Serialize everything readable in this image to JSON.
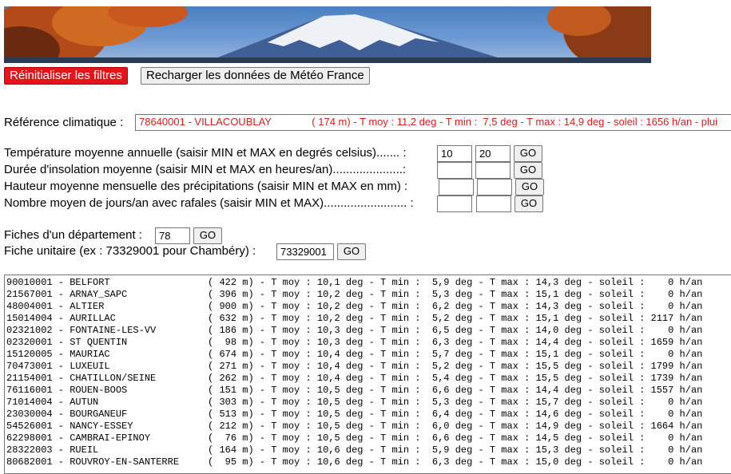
{
  "buttons": {
    "reset": "Réinitialiser les filtres",
    "reload": "Recharger les données de Météo France"
  },
  "reference": {
    "label": "Référence climatique :",
    "value": "78640001 - VILLACOUBLAY              ( 174 m) - T moy : 11,2 deg - T min :  7,5 deg - T max : 14,9 deg - soleil : 1656 h/an - plui"
  },
  "filters": [
    {
      "label": "Température moyenne annuelle (saisir MIN et MAX en degrés celsius)....... :",
      "min": "10",
      "max": "20",
      "go": "GO"
    },
    {
      "label": "Durée d'insolation moyenne (saisir MIN et MAX en heures/an).....................:",
      "min": "",
      "max": "",
      "go": "GO"
    },
    {
      "label": "Hauteur moyenne mensuelle des précipitations (saisir MIN et MAX en mm) :",
      "min": "",
      "max": "",
      "go": "GO"
    },
    {
      "label": "Nombre moyen de jours/an avec rafales (saisir MIN et MAX)......................... :",
      "min": "",
      "max": "",
      "go": "GO"
    }
  ],
  "departement": {
    "label": "Fiches d'un département :",
    "value": "78",
    "go": "GO"
  },
  "unitaire": {
    "label": "Fiche unitaire (ex : 73329001 pour Chambéry) :",
    "value": "73329001",
    "go": "GO"
  },
  "stations": [
    "90010001 - BELFORT                 ( 422 m) - T moy : 10,1 deg - T min :  5,9 deg - T max : 14,3 deg - soleil :    0 h/an",
    "21567001 - ARNAY_SAPC              ( 396 m) - T moy : 10,2 deg - T min :  5,3 deg - T max : 15,1 deg - soleil :    0 h/an",
    "48004001 - ALTIER                  ( 900 m) - T moy : 10,2 deg - T min :  6,2 deg - T max : 14,3 deg - soleil :    0 h/an",
    "15014004 - AURILLAC                ( 632 m) - T moy : 10,2 deg - T min :  5,2 deg - T max : 15,1 deg - soleil : 2117 h/an",
    "02321002 - FONTAINE-LES-VV         ( 186 m) - T moy : 10,3 deg - T min :  6,5 deg - T max : 14,0 deg - soleil :    0 h/an",
    "02320001 - ST QUENTIN              (  98 m) - T moy : 10,3 deg - T min :  6,3 deg - T max : 14,4 deg - soleil : 1659 h/an",
    "15120005 - MAURIAC                 ( 674 m) - T moy : 10,4 deg - T min :  5,7 deg - T max : 15,1 deg - soleil :    0 h/an",
    "70473001 - LUXEUIL                 ( 271 m) - T moy : 10,4 deg - T min :  5,2 deg - T max : 15,5 deg - soleil : 1799 h/an",
    "21154001 - CHATILLON/SEINE         ( 262 m) - T moy : 10,4 deg - T min :  5,4 deg - T max : 15,5 deg - soleil : 1739 h/an",
    "76116001 - ROUEN-BOOS              ( 151 m) - T moy : 10,5 deg - T min :  6,6 deg - T max : 14,4 deg - soleil : 1557 h/an",
    "71014004 - AUTUN                   ( 303 m) - T moy : 10,5 deg - T min :  5,3 deg - T max : 15,7 deg - soleil :    0 h/an",
    "23030004 - BOURGANEUF              ( 513 m) - T moy : 10,5 deg - T min :  6,4 deg - T max : 14,6 deg - soleil :    0 h/an",
    "54526001 - NANCY-ESSEY             ( 212 m) - T moy : 10,5 deg - T min :  6,0 deg - T max : 14,9 deg - soleil : 1664 h/an",
    "62298001 - CAMBRAI-EPINOY          (  76 m) - T moy : 10,5 deg - T min :  6,6 deg - T max : 14,5 deg - soleil :    0 h/an",
    "28322003 - RUEIL                   ( 164 m) - T moy : 10,6 deg - T min :  5,9 deg - T max : 15,3 deg - soleil :    0 h/an",
    "80682001 - ROUVROY-EN-SANTERRE     (  95 m) - T moy : 10,6 deg - T min :  6,3 deg - T max : 15,0 deg - soleil :    0 h/an"
  ]
}
